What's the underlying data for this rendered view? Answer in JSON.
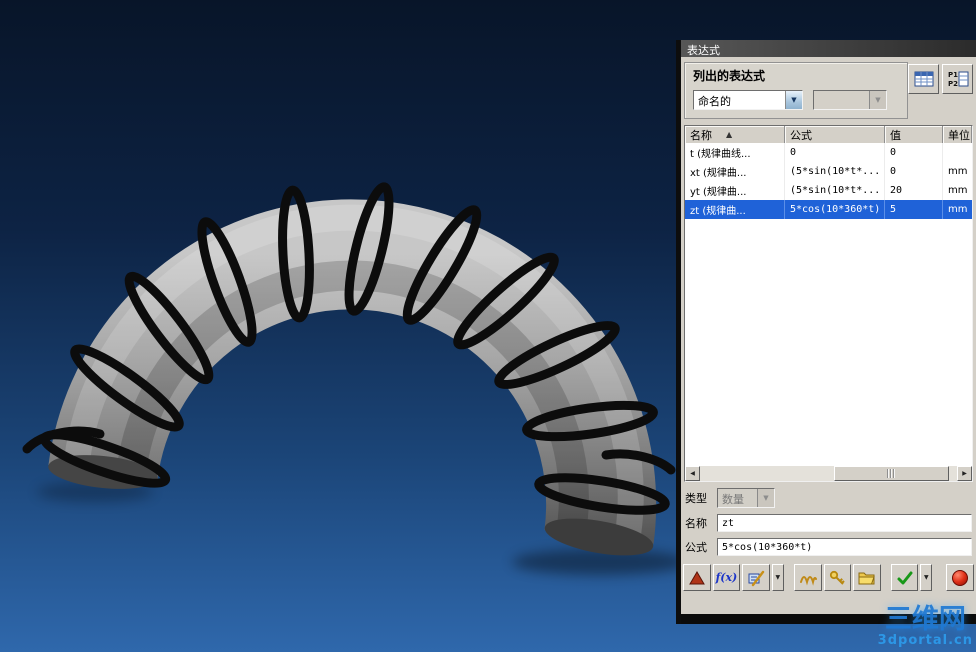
{
  "glyphs": {
    "down_arrow": "▼",
    "left_arrow": "◀",
    "right_arrow": "▶",
    "sort_asc": "▲"
  },
  "watermark": {
    "line1": "三维网",
    "line2": "3dportal.cn"
  },
  "dialog": {
    "title": "表达式",
    "listed_group": {
      "label": "列出的表达式",
      "filter_value": "命名的"
    },
    "header_buttons": {
      "p1": "P1",
      "p2": "P2"
    },
    "table": {
      "columns": [
        "名称",
        "公式",
        "值",
        "单位"
      ],
      "rows": [
        {
          "name": "t  (规律曲线...",
          "formula": "0",
          "value": "0",
          "unit": ""
        },
        {
          "name": "xt (规律曲...",
          "formula": "(5*sin(10*t*...",
          "value": "0",
          "unit": "mm"
        },
        {
          "name": "yt (规律曲...",
          "formula": "(5*sin(10*t*...",
          "value": "20",
          "unit": "mm"
        },
        {
          "name": "zt (规律曲...",
          "formula": "5*cos(10*360*t)",
          "value": "5",
          "unit": "mm"
        }
      ]
    },
    "fields": {
      "type_label": "类型",
      "type_value": "数量",
      "name_label": "名称",
      "name_value": "zt",
      "formula_label": "公式",
      "formula_value": "5*cos(10*360*t)"
    },
    "toolbar": {
      "fx_label": "f(x)",
      "icons": [
        "export-triangle-icon",
        "function-fx-icon",
        "format-editor-icon",
        "spring-icon",
        "key-icon",
        "open-folder-icon",
        "apply-check-icon",
        "cancel-ball-icon"
      ]
    }
  }
}
